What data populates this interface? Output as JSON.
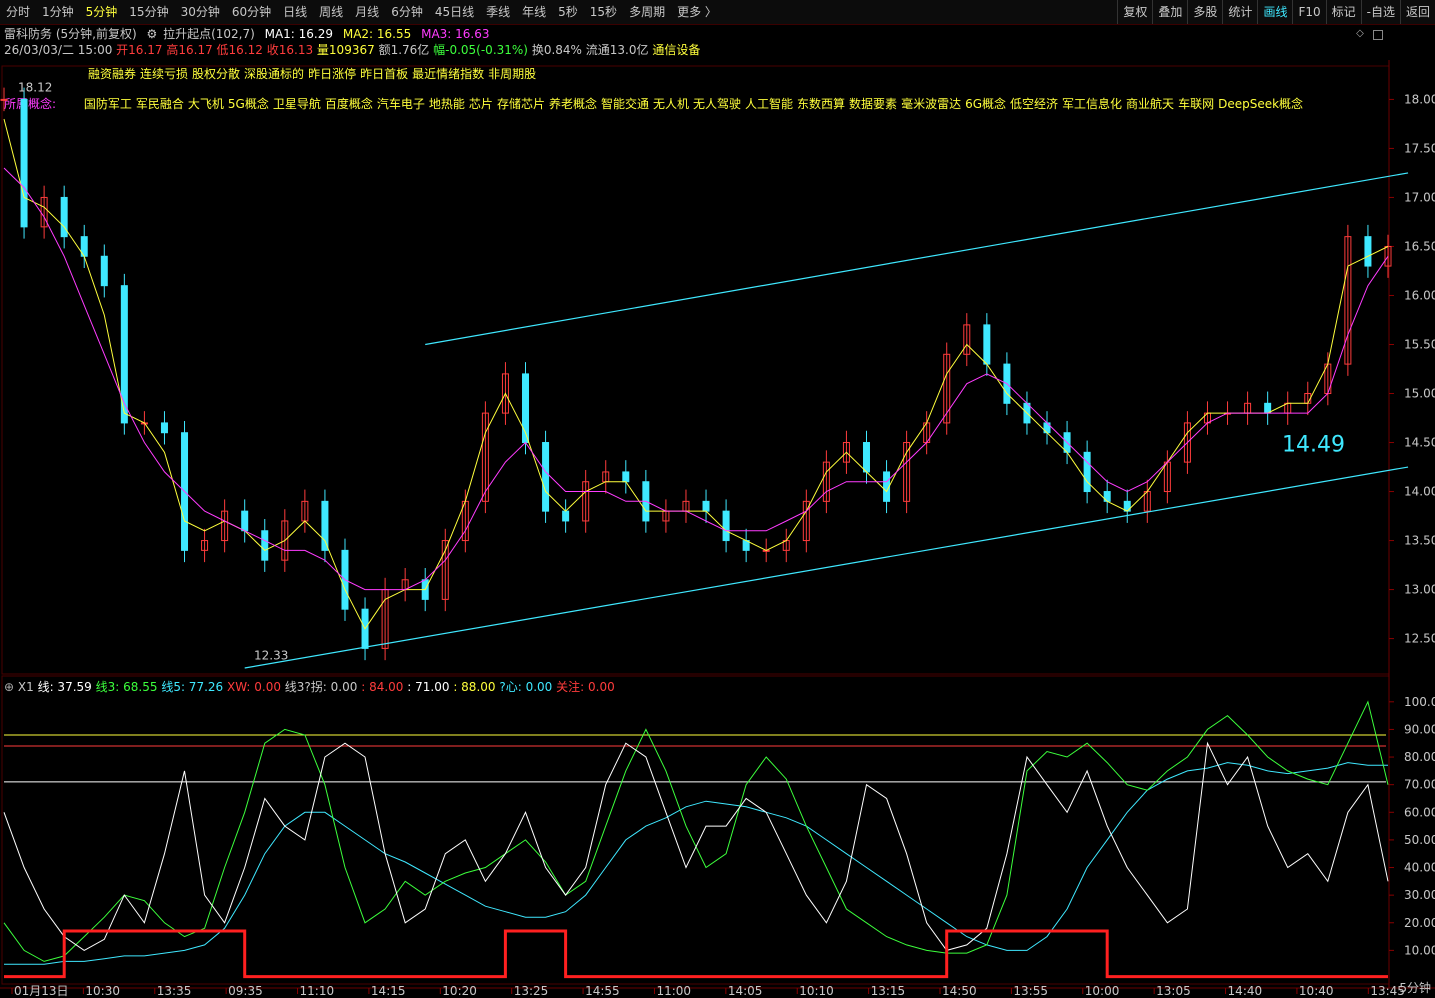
{
  "periods": [
    "分时",
    "1分钟",
    "5分钟",
    "15分钟",
    "30分钟",
    "60分钟",
    "日线",
    "周线",
    "月线",
    "6分钟",
    "45日线",
    "季线",
    "年线",
    "5秒",
    "15秒",
    "多周期",
    "更多 〉"
  ],
  "active_period": "5分钟",
  "right_tools": [
    "复权",
    "叠加",
    "多股",
    "统计",
    "画线",
    "F10",
    "标记",
    "-自选",
    "返回"
  ],
  "active_tool": "画线",
  "header": {
    "stock": "雷科防务 (5分钟,前复权)",
    "indicator": "拉升起点(102,7)",
    "ma1": "MA1: 16.29",
    "ma2": "MA2: 16.55",
    "ma3": "MA3: 16.63"
  },
  "quote": {
    "date": "26/03/03/二 15:00",
    "open": "开16.17",
    "high": "高16.17",
    "low": "低16.12",
    "close": "收16.13",
    "vol": "量109367",
    "amt": "额1.76亿",
    "chg": "幅-0.05(-0.31%)",
    "turn": "换0.84%",
    "float": "流通13.0亿",
    "ind": "通信设备"
  },
  "tags_row1": [
    "融资融券",
    "连续亏损",
    "股权分散",
    "深股通标的",
    "昨日涨停",
    "昨日首板",
    "最近情绪指数",
    "非周期股"
  ],
  "concept_label": "所属概念:",
  "concepts": [
    "国防军工",
    "军民融合",
    "大飞机",
    "5G概念",
    "卫星导航",
    "百度概念",
    "汽车电子",
    "地热能",
    "芯片",
    "存储芯片",
    "养老概念",
    "智能交通",
    "无人机",
    "无人驾驶",
    "人工智能",
    "东数西算",
    "数据要素",
    "毫米波雷达",
    "6G概念",
    "低空经济",
    "军工信息化",
    "商业航天",
    "车联网",
    "DeepSeek概念"
  ],
  "annotations": {
    "max": "18.12",
    "min": "12.33",
    "note": "14.49"
  },
  "indicator_header": {
    "name": "X1",
    "v1": "线: 37.59",
    "v2": "线3: 68.55",
    "v3": "线5: 77.26",
    "v4": "XW: 0.00",
    "v5": "线3?拐: 0.00",
    "v6": ": 84.00",
    "v7": ": 71.00",
    "v8": ": 88.00",
    "v9": "?心: 0.00",
    "v10": "关注: 0.00"
  },
  "period_label": "5分钟",
  "colors": {
    "bg": "#000000",
    "up": "#ff3c3c",
    "down": "#3fe8ff",
    "ma1": "#ffffff",
    "ma2": "#ffff3c",
    "ma3": "#ff3cff",
    "channel": "#3fe8ff"
  },
  "chart_data": {
    "type": "line",
    "title": "雷科防务 5分钟",
    "ylim": [
      12.2,
      18.3
    ],
    "yticks": [
      12.5,
      13.0,
      13.5,
      14.0,
      14.5,
      15.0,
      15.5,
      16.0,
      16.5,
      17.0,
      17.5,
      18.0
    ],
    "xticks": [
      "01月13日",
      "10:30",
      "13:35",
      "09:35",
      "11:10",
      "14:15",
      "10:20",
      "13:25",
      "14:55",
      "11:00",
      "14:05",
      "10:10",
      "13:15",
      "14:50",
      "13:55",
      "10:00",
      "13:05",
      "14:40",
      "10:40",
      "13:45"
    ],
    "price": [
      18.0,
      16.7,
      17.0,
      16.6,
      16.4,
      16.1,
      14.7,
      14.7,
      14.6,
      13.4,
      13.5,
      13.8,
      13.6,
      13.3,
      13.7,
      13.9,
      13.4,
      12.8,
      12.4,
      13.0,
      13.1,
      12.9,
      13.5,
      13.9,
      14.8,
      15.2,
      14.5,
      13.8,
      13.7,
      14.1,
      14.2,
      14.1,
      13.7,
      13.8,
      13.9,
      13.8,
      13.5,
      13.4,
      13.4,
      13.5,
      13.9,
      14.3,
      14.5,
      14.2,
      13.9,
      14.5,
      14.7,
      15.4,
      15.7,
      15.3,
      14.9,
      14.7,
      14.6,
      14.4,
      14.0,
      13.9,
      13.8,
      14.0,
      14.3,
      14.7,
      14.8,
      14.8,
      14.9,
      14.8,
      14.9,
      15.0,
      15.3,
      16.6,
      16.3,
      16.5
    ],
    "ma_short": [
      17.8,
      17.0,
      16.9,
      16.7,
      16.4,
      15.8,
      14.8,
      14.7,
      14.4,
      13.7,
      13.6,
      13.7,
      13.6,
      13.4,
      13.5,
      13.7,
      13.5,
      13.0,
      12.6,
      12.9,
      13.0,
      13.0,
      13.4,
      13.9,
      14.6,
      15.0,
      14.6,
      14.0,
      13.8,
      14.0,
      14.1,
      14.1,
      13.8,
      13.8,
      13.8,
      13.8,
      13.6,
      13.5,
      13.4,
      13.5,
      13.8,
      14.2,
      14.4,
      14.2,
      14.0,
      14.4,
      14.7,
      15.2,
      15.5,
      15.3,
      15.0,
      14.8,
      14.6,
      14.4,
      14.1,
      13.9,
      13.8,
      14.0,
      14.3,
      14.6,
      14.8,
      14.8,
      14.8,
      14.8,
      14.9,
      14.9,
      15.3,
      16.3,
      16.4,
      16.5
    ],
    "ma_long": [
      17.3,
      17.1,
      16.8,
      16.4,
      15.9,
      15.4,
      14.9,
      14.5,
      14.2,
      14.0,
      13.8,
      13.7,
      13.6,
      13.5,
      13.4,
      13.4,
      13.3,
      13.1,
      13.0,
      13.0,
      13.0,
      13.1,
      13.3,
      13.6,
      14.0,
      14.3,
      14.5,
      14.2,
      14.0,
      14.0,
      14.0,
      13.9,
      13.9,
      13.8,
      13.8,
      13.7,
      13.6,
      13.6,
      13.6,
      13.7,
      13.8,
      14.0,
      14.1,
      14.1,
      14.1,
      14.3,
      14.5,
      14.8,
      15.1,
      15.2,
      15.1,
      14.9,
      14.7,
      14.5,
      14.3,
      14.1,
      14.0,
      14.1,
      14.3,
      14.5,
      14.7,
      14.8,
      14.8,
      14.8,
      14.8,
      14.8,
      15.0,
      15.6,
      16.1,
      16.4
    ],
    "channel_upper": [
      [
        21,
        15.5
      ],
      [
        70,
        17.25
      ]
    ],
    "channel_lower": [
      [
        12,
        12.2
      ],
      [
        70,
        14.25
      ]
    ],
    "indicator": {
      "ylim": [
        0,
        105
      ],
      "yticks": [
        10,
        20,
        30,
        40,
        50,
        60,
        70,
        80,
        90,
        100
      ],
      "hlines": [
        88,
        84,
        71
      ],
      "white": [
        60,
        40,
        25,
        15,
        10,
        14,
        30,
        20,
        45,
        75,
        30,
        20,
        40,
        65,
        55,
        50,
        80,
        85,
        80,
        45,
        20,
        25,
        45,
        50,
        35,
        45,
        60,
        40,
        30,
        40,
        70,
        85,
        80,
        60,
        40,
        55,
        55,
        65,
        60,
        45,
        30,
        20,
        35,
        70,
        65,
        45,
        20,
        10,
        12,
        18,
        45,
        80,
        70,
        60,
        75,
        55,
        40,
        30,
        20,
        25,
        85,
        70,
        80,
        55,
        40,
        45,
        35,
        60,
        70,
        35
      ],
      "green": [
        20,
        10,
        6,
        8,
        15,
        22,
        30,
        28,
        20,
        15,
        18,
        40,
        60,
        85,
        90,
        88,
        70,
        40,
        20,
        25,
        35,
        30,
        35,
        38,
        40,
        45,
        50,
        42,
        30,
        35,
        55,
        75,
        90,
        75,
        55,
        40,
        45,
        70,
        80,
        72,
        55,
        40,
        25,
        20,
        15,
        12,
        10,
        9,
        9,
        12,
        30,
        75,
        82,
        80,
        85,
        78,
        70,
        68,
        75,
        80,
        90,
        95,
        88,
        80,
        75,
        72,
        70,
        85,
        100,
        70
      ],
      "cyan": [
        5,
        5,
        5,
        6,
        6,
        7,
        8,
        8,
        9,
        10,
        12,
        18,
        30,
        45,
        55,
        60,
        60,
        55,
        50,
        45,
        42,
        38,
        34,
        30,
        26,
        24,
        22,
        22,
        24,
        30,
        40,
        50,
        55,
        58,
        62,
        64,
        63,
        62,
        60,
        58,
        55,
        50,
        45,
        40,
        35,
        30,
        25,
        20,
        15,
        12,
        10,
        10,
        15,
        25,
        40,
        50,
        60,
        68,
        72,
        75,
        76,
        78,
        77,
        75,
        74,
        75,
        76,
        78,
        77,
        77
      ],
      "red_step": [
        0,
        0,
        0,
        17,
        17,
        17,
        17,
        17,
        17,
        17,
        17,
        17,
        0,
        0,
        0,
        0,
        0,
        0,
        0,
        0,
        0,
        0,
        0,
        0,
        0,
        17,
        17,
        17,
        0,
        0,
        0,
        0,
        0,
        0,
        0,
        0,
        0,
        0,
        0,
        0,
        0,
        0,
        0,
        0,
        0,
        0,
        0,
        17,
        17,
        17,
        17,
        17,
        17,
        17,
        17,
        0,
        0,
        0,
        0,
        0,
        0,
        0,
        0,
        0,
        0,
        0,
        0,
        0,
        0,
        0
      ]
    }
  }
}
